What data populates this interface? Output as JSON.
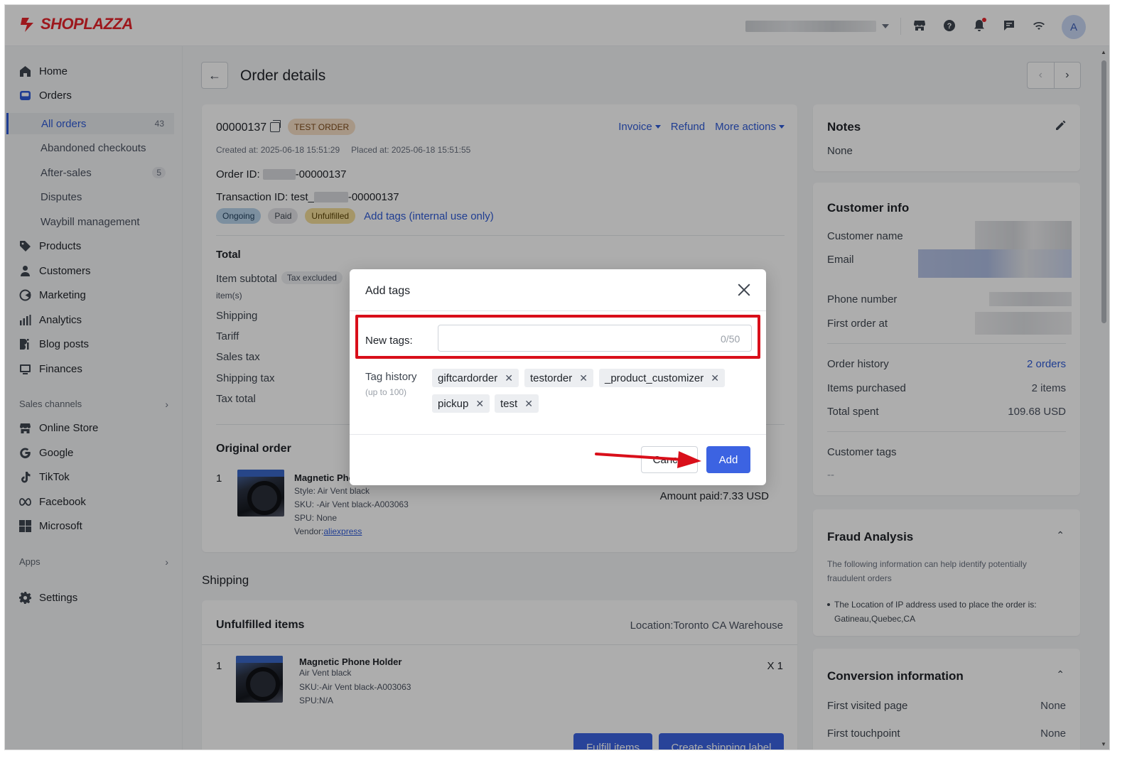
{
  "brand": {
    "name": "SHOPLAZZA",
    "color": "#e8242b"
  },
  "topbar": {
    "avatar_letter": "A",
    "icons": [
      "store-icon",
      "help-icon",
      "bell-icon",
      "chat-icon",
      "wifi-icon"
    ]
  },
  "sidebar": {
    "items": [
      {
        "label": "Home",
        "icon": "home-icon"
      },
      {
        "label": "Orders",
        "icon": "inbox-icon"
      },
      {
        "label": "All orders",
        "count": "43"
      },
      {
        "label": "Abandoned checkouts"
      },
      {
        "label": "After-sales",
        "count": "5"
      },
      {
        "label": "Disputes"
      },
      {
        "label": "Waybill management"
      },
      {
        "label": "Products",
        "icon": "tag-icon"
      },
      {
        "label": "Customers",
        "icon": "person-icon"
      },
      {
        "label": "Marketing",
        "icon": "megaphone-icon"
      },
      {
        "label": "Analytics",
        "icon": "bar-chart-icon"
      },
      {
        "label": "Blog posts",
        "icon": "blog-icon"
      },
      {
        "label": "Finances",
        "icon": "finance-icon"
      }
    ],
    "sales_channels_label": "Sales channels",
    "channels": [
      {
        "label": "Online Store",
        "icon": "store-icon"
      },
      {
        "label": "Google",
        "icon": "google-icon"
      },
      {
        "label": "TikTok",
        "icon": "tiktok-icon"
      },
      {
        "label": "Facebook",
        "icon": "meta-icon"
      },
      {
        "label": "Microsoft",
        "icon": "microsoft-icon"
      }
    ],
    "apps_label": "Apps",
    "settings_label": "Settings"
  },
  "page": {
    "title": "Order details"
  },
  "order": {
    "number": "00000137",
    "badge": "TEST ORDER",
    "actions": {
      "invoice": "Invoice",
      "refund": "Refund",
      "more": "More actions"
    },
    "created_label": "Created at:",
    "created_value": "2025-06-18 15:51:29",
    "placed_label": "Placed at:",
    "placed_value": "2025-06-18 15:51:55",
    "order_id_label": "Order ID:",
    "order_id_suffix": "-00000137",
    "transaction_label": "Transaction ID: test_",
    "transaction_suffix": "-00000137",
    "statuses": [
      "Ongoing",
      "Paid",
      "Unfulfilled"
    ],
    "add_tags_link": "Add tags (internal use only)",
    "total_title": "Total",
    "item_subtotal": "Item subtotal",
    "tax_excluded": "Tax excluded",
    "items_suffix": "item(s)",
    "summary_rows": [
      "Shipping",
      "Tariff",
      "Sales tax",
      "Shipping tax",
      "Tax total"
    ],
    "original_order_title": "Original order",
    "product": {
      "index": "1",
      "name": "Magnetic Pho",
      "style": "Style: Air Vent black",
      "sku": "SKU: -Air Vent black-A003063",
      "spu": "SPU: None",
      "vendor_label": "Vendor:",
      "vendor": "aliexpress"
    },
    "amount_paid": "Amount paid:7.33 USD"
  },
  "shipping": {
    "title": "Shipping",
    "unfulfilled_title": "Unfulfilled items",
    "location": "Location:Toronto CA Warehouse",
    "item": {
      "index": "1",
      "name": "Magnetic Phone Holder",
      "variant": "Air Vent black",
      "sku": "SKU:-Air Vent black-A003063",
      "spu": "SPU:N/A",
      "qty": "X 1"
    },
    "fulfill_button": "Fulfill items",
    "label_button": "Create shipping label"
  },
  "notes": {
    "title": "Notes",
    "value": "None"
  },
  "customer": {
    "title": "Customer info",
    "name_label": "Customer name",
    "email_label": "Email",
    "phone_label": "Phone number",
    "first_order_label": "First order at",
    "order_history_label": "Order history",
    "order_history_value": "2 orders",
    "items_purchased_label": "Items purchased",
    "items_purchased_value": "2 items",
    "total_spent_label": "Total spent",
    "total_spent_value": "109.68 USD",
    "tags_label": "Customer tags",
    "tags_value": "--"
  },
  "fraud": {
    "title": "Fraud Analysis",
    "description": "The following information can help identify potentially fraudulent orders",
    "bullet": "The Location of IP address used to place the order is: Gatineau,Quebec,CA"
  },
  "conversion": {
    "title": "Conversion information",
    "first_visited_label": "First visited page",
    "first_visited_value": "None",
    "first_touch_label": "First touchpoint",
    "first_touch_value": "None"
  },
  "modal": {
    "title": "Add tags",
    "new_tags_label": "New tags:",
    "input_value": "",
    "input_placeholder": "",
    "counter": "0/50",
    "history_label": "Tag history",
    "history_sub": "(up to 100)",
    "tags": [
      "giftcardorder",
      "testorder",
      "_product_customizer",
      "pickup",
      "test"
    ],
    "cancel": "Cancel",
    "add": "Add"
  },
  "colors": {
    "accent": "#3c63e2",
    "highlight": "#d90f1a",
    "link": "#2f5bd7"
  }
}
